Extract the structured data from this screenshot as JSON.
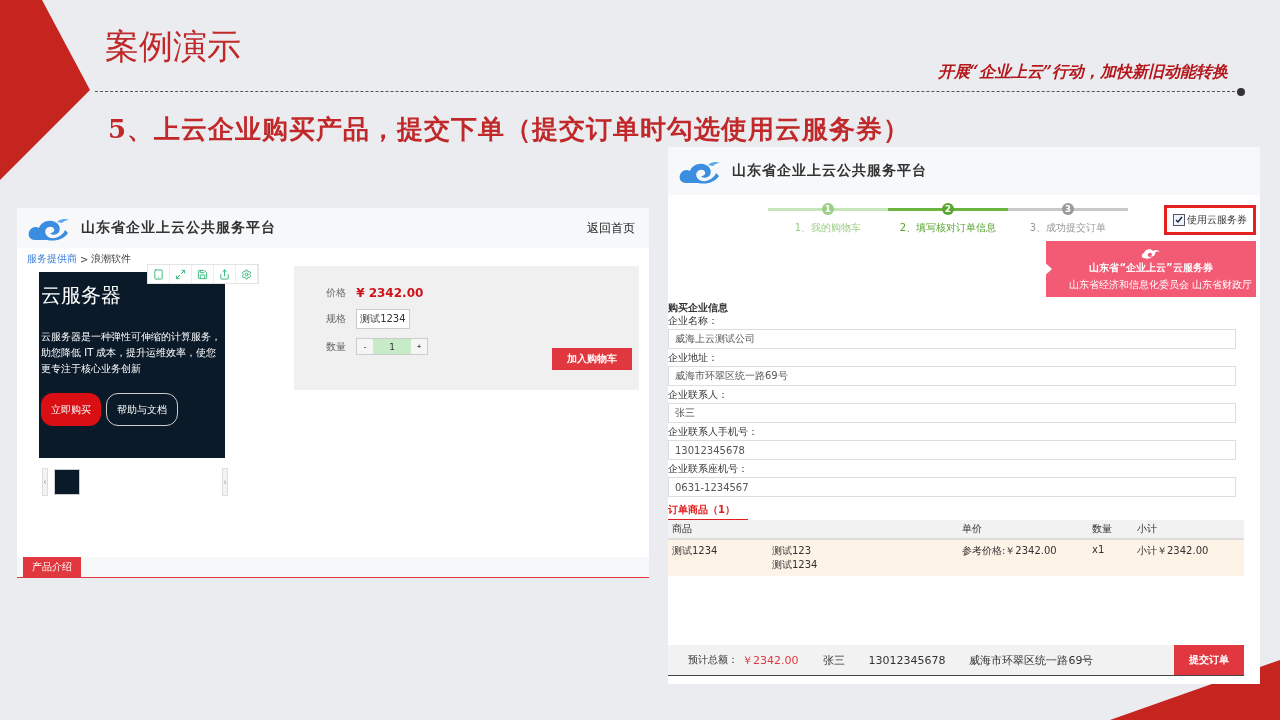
{
  "slide": {
    "title": "案例演示",
    "slogan": "开展“企业上云”行动，加快新旧动能转换",
    "heading": "5、上云企业购买产品，提交下单（提交订单时勾选使用云服务券）"
  },
  "product_page": {
    "site_title": "山东省企业上云公共服务平台",
    "home_link": "返回首页",
    "breadcrumb": [
      {
        "text": "服务提供商",
        "kind": "link"
      },
      {
        "text": ">",
        "kind": "separator"
      },
      {
        "text": "浪潮软件",
        "kind": "text"
      }
    ],
    "banner": {
      "title": "云服务器",
      "description": "云服务器是一种弹性可伸缩的计算服务，助您降低 IT 成本，提升运维效率，使您更专注于核心业务创新",
      "buttons": [
        {
          "label": "立即购买",
          "kind": "primary"
        },
        {
          "label": "帮助与文档",
          "kind": "outline"
        }
      ]
    },
    "gallery": {
      "prev": "‹",
      "next": "›"
    },
    "price_label": "价格",
    "price": "¥ 2342.00",
    "spec_label": "规格",
    "spec": "测试1234",
    "quantity_label": "数量",
    "quantity": {
      "minus": "-",
      "value": "1",
      "plus": "+"
    },
    "add_to_cart": "加入购物车",
    "tabs": [
      {
        "label": "产品介绍",
        "selected": true
      }
    ]
  },
  "order_page": {
    "site_title": "山东省企业上云公共服务平台",
    "steps": [
      {
        "number": "1",
        "label": "1、我的购物车",
        "done": true,
        "selected": false
      },
      {
        "number": "2",
        "label": "2、填写核对订单信息",
        "done": false,
        "selected": true
      },
      {
        "number": "3",
        "label": "3、成功提交订单",
        "done": false,
        "selected": false
      }
    ],
    "coupon_option": {
      "label": "使用云服务券",
      "checked": true
    },
    "coupon": {
      "title": "山东省“企业上云”云服务券",
      "issuer": "山东省经济和信息化委员会 山东省财政厅"
    },
    "section_title": "购买企业信息",
    "fields": [
      {
        "label": "企业名称：",
        "value": "威海上云测试公司"
      },
      {
        "label": "企业地址：",
        "value": "威海市环翠区统一路69号"
      },
      {
        "label": "企业联系人：",
        "value": "张三"
      },
      {
        "label": "企业联系人手机号：",
        "value": "13012345678"
      },
      {
        "label": "企业联系座机号：",
        "value": "0631-1234567"
      }
    ],
    "order_title": "订单商品（1）",
    "columns": [
      "商品",
      "单价",
      "数量",
      "小计"
    ],
    "rows": [
      {
        "product": "测试1234",
        "specs": [
          "测试123",
          "测试1234"
        ],
        "price": "参考价格:￥2342.00",
        "quantity": "x1",
        "subtotal": "小计￥2342.00"
      }
    ],
    "footer": {
      "total_label": "预计总额：",
      "total": "￥2342.00",
      "name": "张三",
      "phone": "13012345678",
      "address": "威海市环翠区统一路69号",
      "submit": "提交订单"
    }
  }
}
